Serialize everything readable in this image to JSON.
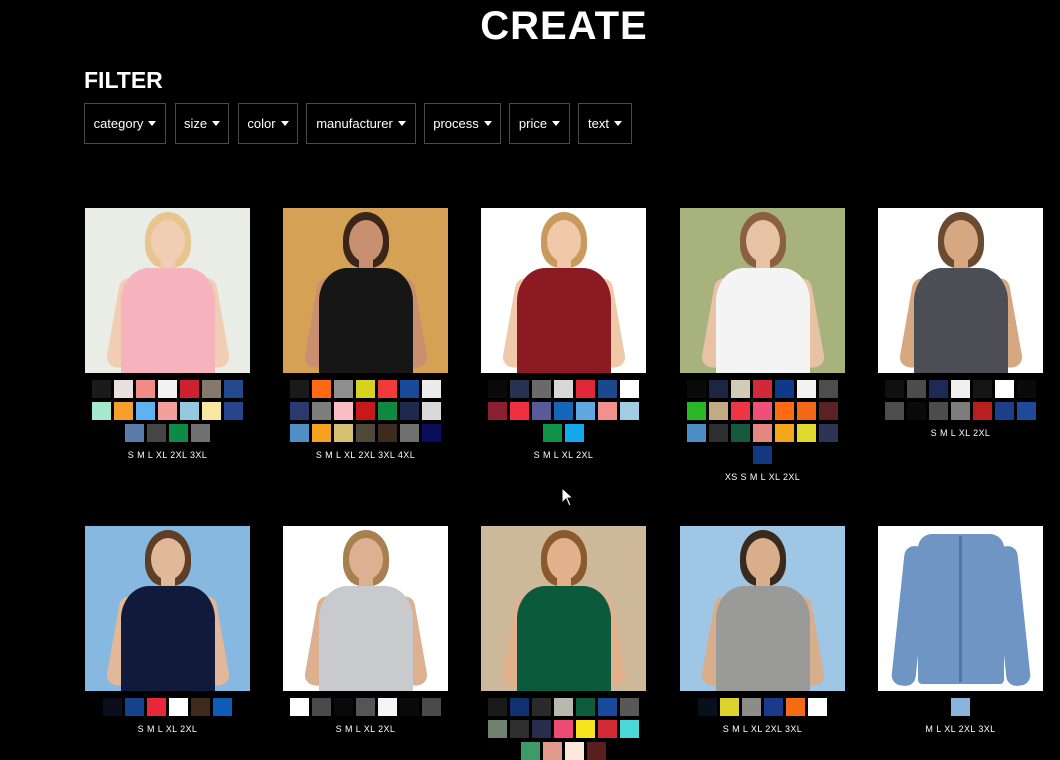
{
  "page": {
    "title": "CREATE"
  },
  "filter": {
    "heading": "FILTER",
    "buttons": [
      "category",
      "size",
      "color",
      "manufacturer",
      "process",
      "price",
      "text"
    ]
  },
  "products": [
    {
      "photo": {
        "bg": "#e9ede6",
        "shirt": "#f6b3bd",
        "skin": "#f0cdb3",
        "hair": "#e6c58e",
        "icon": "woman-pink-tee-photo"
      },
      "swatches": [
        "#1a1a1a",
        "#e8e0dc",
        "#f08b86",
        "#f2f2f2",
        "#d02030",
        "#86786a",
        "#23498d",
        "#a6e8d0",
        "#f4a02a",
        "#5fb2f0",
        "#f4a09a",
        "#94c9e0",
        "#f8e7a0",
        "#27458a",
        "#5a7ca8",
        "#454545",
        "#0e8a46",
        "#707070"
      ],
      "sizes": "S M L XL 2XL 3XL"
    },
    {
      "photo": {
        "bg": "#d5a255",
        "shirt": "#161616",
        "skin": "#c89070",
        "hair": "#3a2518",
        "icon": "man-black-tee-photo"
      },
      "swatches": [
        "#1a1a1a",
        "#ff6a13",
        "#8f8f8f",
        "#d6d21f",
        "#f23a3a",
        "#184a9a",
        "#ececec",
        "#2b3a6c",
        "#7d7d7d",
        "#fbbbc7",
        "#c61a1a",
        "#0d8a3e",
        "#1d2a4e",
        "#d9d9d9",
        "#4f8ec6",
        "#f7a21e",
        "#d6c071",
        "#4d4a3a",
        "#3f2a20",
        "#6f6f6f",
        "#0a0e5a"
      ],
      "sizes": "S M L XL 2XL 3XL 4XL"
    },
    {
      "photo": {
        "bg": "#ffffff",
        "shirt": "#8b1a22",
        "skin": "#f0c8aa",
        "hair": "#c89b5c",
        "icon": "woman-maroon-vneck-photo"
      },
      "swatches": [
        "#0a0a0a",
        "#263250",
        "#6a6a6a",
        "#d8d8d8",
        "#e2273a",
        "#1d4890",
        "#ffffff",
        "#8c2030",
        "#ef3040",
        "#5a5a9a",
        "#1466b8",
        "#62a8e0",
        "#f2908e",
        "#a2cce4",
        "#0f9147",
        "#14a8ec"
      ],
      "sizes": "S M L XL 2XL"
    },
    {
      "photo": {
        "bg": "#a7b27c",
        "shirt": "#f4f4f4",
        "skin": "#e8c2a4",
        "hair": "#8a6040",
        "icon": "woman-white-tee-photo"
      },
      "swatches": [
        "#0a0a0a",
        "#1c2642",
        "#d3cbb4",
        "#d12a36",
        "#0f3a8a",
        "#f2f2f2",
        "#4d4d4d",
        "#27b823",
        "#c2ab82",
        "#ef3444",
        "#ef4f78",
        "#ff6a12",
        "#f36818",
        "#5a2222",
        "#4b8ec6",
        "#2e2e2e",
        "#155a3a",
        "#e28880",
        "#f5a51c",
        "#e0d82a",
        "#2d3454",
        "#123880"
      ],
      "sizes": "XS S M L XL 2XL"
    },
    {
      "photo": {
        "bg": "#ffffff",
        "shirt": "#4d4e55",
        "skin": "#d6a882",
        "hair": "#6a4a30",
        "icon": "man-grey-pocket-tee-photo"
      },
      "swatches": [
        "#101010",
        "#4c4c4c",
        "#1d2a56",
        "#f0f0f0",
        "#151515",
        "#ffffff",
        "#0a0a0a",
        "#4d4d4d",
        "#0a0a0a",
        "#4c4c4c",
        "#7d7d7d",
        "#b82020",
        "#1c3f8a",
        "#1d4a9a"
      ],
      "sizes": "S M L XL 2XL"
    },
    {
      "photo": {
        "bg": "#86b8e0",
        "shirt": "#111a3a",
        "skin": "#e2b89a",
        "hair": "#5e3e26",
        "icon": "woman-navy-polo-photo"
      },
      "swatches": [
        "#0b0f1c",
        "#16418c",
        "#e8283a",
        "#ffffff",
        "#3d2a1a",
        "#0f5cb8"
      ],
      "sizes": "S M L XL 2XL"
    },
    {
      "photo": {
        "bg": "#ffffff",
        "shirt": "#c8cace",
        "skin": "#dcb090",
        "hair": "#a88050",
        "icon": "man-grey-longsleeve-photo"
      },
      "swatches": [
        "#ffffff",
        "#4a4a4a",
        "#0a0a0a",
        "#555555",
        "#f5f5f5",
        "#0a0a0a",
        "#4a4a4a"
      ],
      "sizes": "S M L XL 2XL"
    },
    {
      "photo": {
        "bg": "#cdb89a",
        "shirt": "#0b5a3e",
        "skin": "#e2b08a",
        "hair": "#8a5a2e",
        "icon": "man-green-hoodie-photo"
      },
      "swatches": [
        "#1a1a1a",
        "#11306e",
        "#2a2a2a",
        "#b8b8b0",
        "#0d5c3c",
        "#174a9a",
        "#585858",
        "#6f8270",
        "#2e2e2e",
        "#2a2c4e",
        "#ef4a72",
        "#f6e51e",
        "#d42a36",
        "#4ad8d8",
        "#3f9a6a",
        "#e29a8c",
        "#fde8dc",
        "#5a2020"
      ],
      "sizes": ""
    },
    {
      "photo": {
        "bg": "#9fc6e4",
        "shirt": "#9a9a98",
        "skin": "#d8ae8c",
        "hair": "#3a2a1e",
        "icon": "man-grey-zip-hoodie-photo"
      },
      "swatches": [
        "#0a0f1e",
        "#dcd42c",
        "#8c8c88",
        "#1a3a8c",
        "#f56a14",
        "#ffffff"
      ],
      "sizes": "S M L XL 2XL 3XL"
    },
    {
      "photo": {
        "bg": "#ffffff",
        "shirt": "#6e95c4",
        "skin": "#ffffff",
        "hair": "#ffffff",
        "icon": "denim-shirt-photo"
      },
      "swatches": [
        "#8ab4dc"
      ],
      "sizes": "M L XL 2XL 3XL"
    }
  ]
}
